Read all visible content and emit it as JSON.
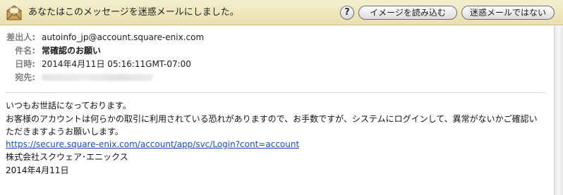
{
  "banner": {
    "message": "あなたはこのメッセージを迷惑メールにしました。",
    "help_label": "?",
    "load_images_label": "イメージを読み込む",
    "not_junk_label": "迷惑メールではない",
    "icon": "junk-mail-icon",
    "background_color": "#ede4ba"
  },
  "headers": {
    "from_label": "差出人:",
    "from_value": "autoinfo_jp@account.square-enix.com",
    "subject_label": "件名:",
    "subject_value": "常確認のお願い",
    "date_label": "日時:",
    "date_value": "2014年4月11日 05:16:11GMT-07:00",
    "to_label": "宛先:"
  },
  "body": {
    "line1": "いつもお世話になっております。",
    "line2": "お客様のアカウントは何らかの取引に利用されている恐れがありますので、お手数ですが、システムにログインして、異常がないかご確認い",
    "line3": "ただきますようお願いします。",
    "link": "https://secure.square-enix.com/account/app/svc/Login?cont=account",
    "company": "株式会社スクウェア･エニックス",
    "date": "2014年4月11日"
  },
  "colors": {
    "link": "#1a4fc0",
    "label_gray": "#7f7f7f"
  }
}
